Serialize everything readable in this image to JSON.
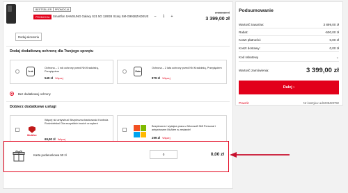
{
  "product": {
    "badges": [
      "BESTSELLER",
      "PROMOCJA"
    ],
    "promo_badge": "PROMOCJA",
    "name": "Smartfon SAMSUNG Galaxy S21 5G 128GB Szary SM-G991BZADEUE",
    "qty_minus": "–",
    "qty": "1",
    "qty_plus": "+",
    "old_price": "3 899,00 zł",
    "price": "3 399,00 zł",
    "add_accessory": "Dodaj akcesoria"
  },
  "protection": {
    "title": "Dodaj dodatkową ochronę dla Twojego sprzętu",
    "option1": {
      "icon_text": "1rok",
      "text": "Ochrona – 1 rok ochrony przed NN Kradzieżą, Przepięciem",
      "price": "549 zł",
      "more": "Więcej"
    },
    "option2": {
      "icon_text": "2lata",
      "text": "Ochrona – 2 lata ochrony przed NN Kradzieżą, Przepięciem",
      "price": "879 zł",
      "more": "Więcej"
    },
    "none_label": "Bez dodatkowej ochrony"
  },
  "services": {
    "title": "Dobierz dodatkowe usługi",
    "service1": {
      "logo": "McAfee",
      "text": "Więcej niż antywirus! Bezpieczna bankowość Kontrola Rodzicielska! Dla wszystkich twoich urządzeń",
      "price": "69,90 zł",
      "more": "Więcej"
    },
    "service2": {
      "text": "Bezpieczna i wydajna praca z Microsoft 365 Personal i antywirusem McAfee w zestawie!",
      "price": "299 zł",
      "more": "Więcej"
    }
  },
  "gift": {
    "label": "Karta podarunkowa 50 zł",
    "qty": "0",
    "price": "0,00 zł"
  },
  "summary": {
    "title": "Podsumowanie",
    "rows": [
      {
        "label": "Wartość towarów:",
        "value": "3 899,00 zł"
      },
      {
        "label": "Rabat:",
        "value": "-500,00 zł"
      },
      {
        "label": "Koszt płatności:",
        "value": "0,00 zł"
      },
      {
        "label": "Koszt dostawy:",
        "value": "0,00 zł"
      }
    ],
    "promo_code_label": "Kod rabatowy",
    "total_label": "Wartość zamówienia:",
    "total_value": "3 399,00 zł",
    "next_button": "Dalej ›",
    "back_link": "Powrót",
    "cart_number": "Nr koszyka: ad1239423792"
  },
  "colors": {
    "accent": "#e2001a",
    "annotation_arrow": "#c8102e"
  }
}
